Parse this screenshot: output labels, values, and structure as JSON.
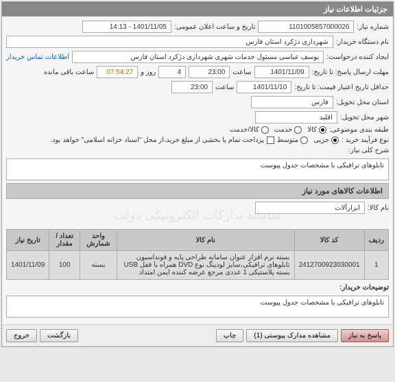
{
  "header": {
    "title": "جزئیات اطلاعات نیاز"
  },
  "main": {
    "need_number_label": "شماره نیاز:",
    "need_number": "1101005857000026",
    "announce_label": "تاریخ و ساعت اعلان عمومی:",
    "announce_value": "1401/11/05 - 14:13",
    "buyer_label": "نام دستگاه خریدار:",
    "buyer_value": "شهرداری دژکرد استان فارس",
    "requester_label": "ایجاد کننده درخواست:",
    "requester_value": "یوسف عباسی مسئول خدمات شهری شهرداری دژکرد استان فارس",
    "contact_link": "اطلاعات تماس خریدار",
    "deadline_label": "مهلت ارسال پاسخ: تا تاریخ:",
    "deadline_date": "1401/11/09",
    "time_label": "ساعت",
    "deadline_time": "23:00",
    "day_label": "روز و",
    "days_remain": "4",
    "remain_time": "07:54:27",
    "remain_suffix": "ساعت باقی مانده",
    "validity_label": "حداقل تاریخ اعتبار قیمت: تا تاریخ:",
    "validity_date": "1401/11/10",
    "validity_time": "23:00",
    "province_label": "استان محل تحویل:",
    "province_value": "فارس",
    "city_label": "شهر محل تحویل:",
    "city_value": "اقلید",
    "category_label": "طبقه بندی موضوعی:",
    "cat_goods": "کالا",
    "cat_service": "خدمت",
    "cat_goods_service": "کالا/خدمت",
    "purchase_type_label": "نوع فرآیند خرید :",
    "pt_partial": "جزیی",
    "pt_medium": "متوسط",
    "payment_note": "پرداخت تمام یا بخشی از مبلغ خرید،از محل \"اسناد خزانه اسلامی\" خواهد بود.",
    "need_desc_label": "شرح کلی نیاز:",
    "need_desc_value": "تابلوهای ترافیکی با مشخصات جدول پیوست",
    "items_section": "اطلاعات کالاهای مورد نیاز",
    "goods_name_label": "نام کالا:",
    "goods_name_value": "ابزارآلات",
    "watermark": "سامانه تدارکات الکترونیکی دولت",
    "table": {
      "headers": {
        "row": "ردیف",
        "code": "کد کالا",
        "name": "نام کالا",
        "unit": "واحد شمارش",
        "qty": "تعداد / مقدار",
        "date": "تاریخ نیاز"
      },
      "rows": [
        {
          "row": "1",
          "code": "2412700923030001",
          "name": "بسته نرم افزار عنوان سامانه طراحی پایه و فونداسیون تابلوهای ترافیکی،سایز لودینگ نوع DVD همراه با قفل USB بسته پلاستیکی 1 عددی مرجع عرضه کننده ایمن امتداد",
          "unit": "بسته",
          "qty": "100",
          "date": "1401/11/09"
        }
      ]
    },
    "buyer_note_label": "توضیحات خریدار:",
    "buyer_note_value": "تابلوهای ترافیکی با مشخصات جدول پیوست"
  },
  "footer": {
    "respond": "پاسخ به نیاز",
    "view_docs": "مشاهده مدارک پیوستی (1)",
    "print": "چاپ",
    "back": "بازگشت",
    "exit": "خروج"
  }
}
